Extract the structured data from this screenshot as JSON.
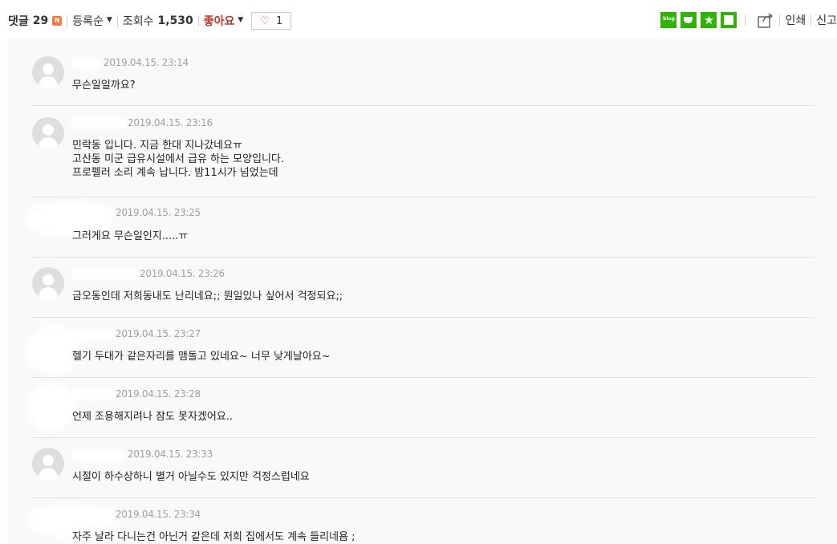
{
  "header": {
    "comments_label": "댓글",
    "comments_count": "29",
    "new_badge": "N",
    "sort_label": "등록순",
    "views_label": "조회수",
    "views_count": "1,530",
    "likes_label": "좋아요",
    "like_count": "1",
    "share_icons": [
      "blog-share-icon",
      "cafe-share-icon",
      "bookmark-star-icon",
      "band-share-icon"
    ],
    "blog_icon_text": "blog",
    "print_label": "인쇄",
    "report_label": "신고"
  },
  "colors": {
    "share_green": "#2db400",
    "like_red": "#c0392b",
    "heart_red": "#e24a4a",
    "new_badge_orange": "#f47b3e",
    "comment_area_bg": "#f9f9f9",
    "timestamp_gray": "#a0a0a0"
  },
  "comments": [
    {
      "timestamp": "2019.04.15. 23:14",
      "lines": [
        "무슨일일까요?"
      ]
    },
    {
      "timestamp": "2019.04.15. 23:16",
      "lines": [
        "민락동 입니다. 지금 한대 지나갔네요ㅠ",
        "고산동 미군 급유시설에서 급유 하는 모양입니다.",
        "프로펠러 소리 계속 납니다. 밤11시가 넘었는데"
      ]
    },
    {
      "timestamp": "2019.04.15. 23:25",
      "lines": [
        "그러게요 무슨일인지.....ㅠ"
      ]
    },
    {
      "timestamp": "2019.04.15. 23:26",
      "lines": [
        "금오동인데 저희동내도 난리네요;; 뭔일있나 싶어서 걱정되요;;"
      ]
    },
    {
      "timestamp": "2019.04.15. 23:27",
      "lines": [
        "헬기 두대가 같은자리를 맴돌고 있네요~ 너무 낮게날아요~"
      ]
    },
    {
      "timestamp": "2019.04.15. 23:28",
      "lines": [
        "언제 조용해지려나 잠도 못자겠어요.."
      ]
    },
    {
      "timestamp": "2019.04.15. 23:33",
      "lines": [
        "시절이 하수상하니 별거 아닐수도 있지만 걱정스럽네요"
      ]
    },
    {
      "timestamp": "2019.04.15. 23:34",
      "lines": [
        "자주 날라 다니는건 아닌거 같은데 저희 집에서도 계속 들리네욤 ;"
      ]
    }
  ]
}
